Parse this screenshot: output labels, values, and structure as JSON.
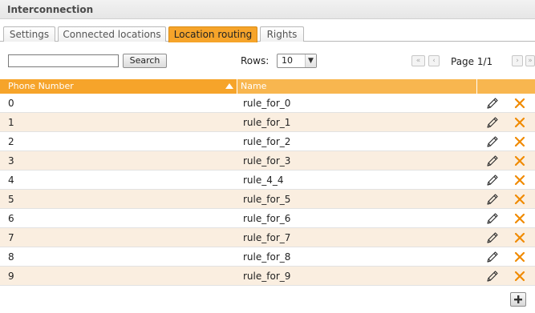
{
  "window": {
    "title": "Interconnection"
  },
  "tabs": [
    {
      "label": "Settings",
      "active": false
    },
    {
      "label": "Connected locations",
      "active": false
    },
    {
      "label": "Location routing",
      "active": true
    },
    {
      "label": "Rights",
      "active": false
    }
  ],
  "toolbar": {
    "search_value": "",
    "search_button": "Search",
    "rows_label": "Rows:",
    "rows_value": "10",
    "page_info": "Page 1/1"
  },
  "grid": {
    "columns": {
      "phone": "Phone Number",
      "name": "Name"
    },
    "sort": "ascending",
    "rows": [
      {
        "phone": "0",
        "name": "rule_for_0"
      },
      {
        "phone": "1",
        "name": "rule_for_1"
      },
      {
        "phone": "2",
        "name": "rule_for_2"
      },
      {
        "phone": "3",
        "name": "rule_for_3"
      },
      {
        "phone": "4",
        "name": "rule_4_4"
      },
      {
        "phone": "5",
        "name": "rule_for_5"
      },
      {
        "phone": "6",
        "name": "rule_for_6"
      },
      {
        "phone": "7",
        "name": "rule_for_7"
      },
      {
        "phone": "8",
        "name": "rule_for_8"
      },
      {
        "phone": "9",
        "name": "rule_for_9"
      }
    ]
  },
  "icons": {
    "edit": "pencil-icon",
    "delete": "close-icon",
    "add": "plus-icon",
    "first": "double-chevron-left-icon",
    "prev": "chevron-left-icon",
    "next": "chevron-right-icon",
    "last": "double-chevron-right-icon"
  },
  "colors": {
    "accent": "#f6a42a",
    "accent_light": "#f8b64f",
    "row_alt": "#faeee0",
    "delete": "#f08a00"
  }
}
